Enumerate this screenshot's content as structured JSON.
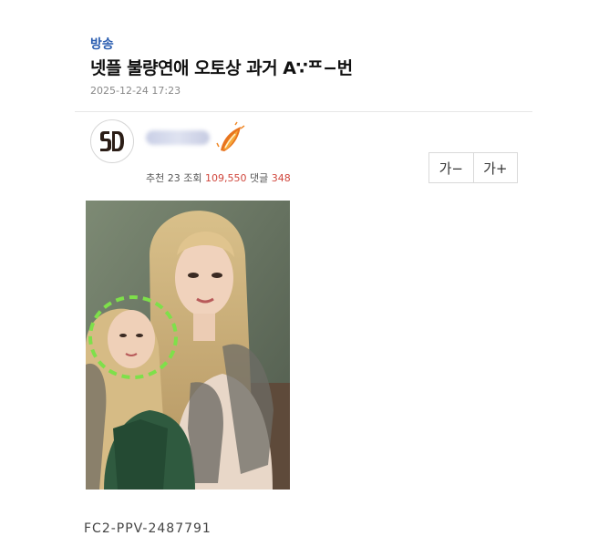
{
  "post": {
    "category": "방송",
    "title": "넷플 불량연애 오토상 과거 A∵ᄑ−번",
    "date": "2025-12-24 17:23"
  },
  "author": {
    "avatar_icon": "padres-sd-logo-icon",
    "badge_icon": "flame-leaf-badge-icon"
  },
  "stats": {
    "recommend_label": "추천",
    "recommend_count": "23",
    "views_label": "조회",
    "views_count": "109,550",
    "comments_label": "댓글",
    "comments_count": "348"
  },
  "font_controls": {
    "decrease_label": "가−",
    "increase_label": "가+"
  },
  "content": {
    "image_icon": "photo-image",
    "caption": "FC2-PPV-2487791"
  },
  "colors": {
    "category": "#2a5db0",
    "stat_highlight": "#d0463c",
    "highlight_circle": "#7ee04a"
  }
}
